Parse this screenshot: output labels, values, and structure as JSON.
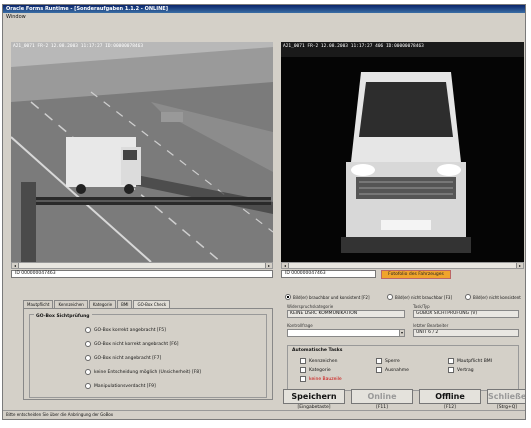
{
  "window": {
    "title": "Oracle Forms Runtime - [Sonderaufgaben 1.1.2 - ONLINE]",
    "menu": "Window"
  },
  "camera_left": {
    "overlay": "A21_0071 FR-2  12.08.2003 11:17:27  ID:00000078463"
  },
  "camera_right": {
    "overlay": "A21_0071 FR-2  12.08.2003 11:17:27 406  ID:00000078463"
  },
  "left": {
    "id_value": "ID 000000047463",
    "tabs": [
      "Mautpflicht",
      "Kennzeichen",
      "Kategorie",
      "BMI",
      "GO-Box Check"
    ],
    "group_title": "GO-Box Sichtprüfung",
    "options": [
      "GO-Box korrekt angebracht [F5]",
      "GO-Box nicht korrekt angebracht [F6]",
      "GO-Box nicht angebracht [F7]",
      "keine Entscheidung möglich (Unsicherheit) [F8]",
      "Manipulationsverdacht [F9]"
    ]
  },
  "right": {
    "id_value": "ID 000000047463",
    "fotofolio_label": "Fotofolio des Fahrzeuges",
    "radios": [
      "Bild(er) brauchbar und konsistent [F2]",
      "Bild(er) nicht brauchbar [F3]",
      "Bild(er) nicht konsistent"
    ],
    "widerspruch_label": "Widerspruchskategorie",
    "widerspruch_value": "KEINE DSRC KOMMUNIKATION",
    "task_label": "Task/Typ",
    "task_value": "GOBOX SICHTPRÜFUNG (V)",
    "kontrollfrage_label": "Kontrollfrage",
    "kontrollfrage_value": "",
    "letzter_label": "letzter Bearbeiter",
    "letzter_value": "UNIT 6 / 2",
    "auto_tasks_title": "Automatische Tasks",
    "auto_tasks": [
      {
        "label": "Kennzeichen",
        "red": false
      },
      {
        "label": "Kategorie",
        "red": false
      },
      {
        "label": "keine Bauzeile",
        "red": true
      },
      {
        "label": "Sperre",
        "red": false
      },
      {
        "label": "Ausnahme",
        "red": false
      },
      {
        "label": "Mautpflicht BMI",
        "red": false
      },
      {
        "label": "Vertrag",
        "red": false
      }
    ]
  },
  "buttons": [
    {
      "label": "Speichern",
      "key": "[Eingabetaste]",
      "enabled": true
    },
    {
      "label": "Online",
      "key": "[F11]",
      "enabled": false
    },
    {
      "label": "Offline",
      "key": "[F12]",
      "enabled": true
    },
    {
      "label": "Schließen",
      "key": "[Strg+Q]",
      "enabled": false
    }
  ],
  "status_text": "Bitte entscheiden Sie über die Anbringung der GoBox",
  "colors": {
    "window_bg": "#d4d0c8",
    "titlebar": "#0a246a",
    "fotofolio": "#f0a42c",
    "alert_text": "#cc0000"
  }
}
